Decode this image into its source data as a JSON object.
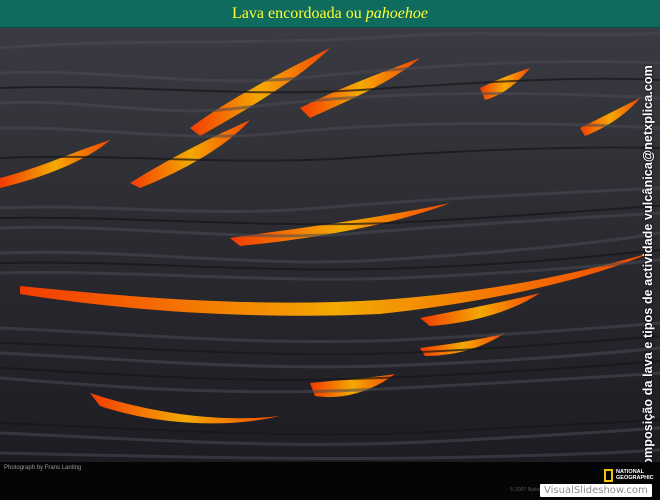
{
  "title": {
    "prefix": "Lava encordoada ou",
    "italic": "pahoehoe"
  },
  "side_caption": "Composição da lava e tipos de actividade vulcânica@netxplica.com",
  "photo_credit": "Photograph by Frans Lanting",
  "copyright": "© 2007 National Geographic Society",
  "ng_logo": {
    "line1": "NATIONAL",
    "line2": "GEOGRAPHIC"
  },
  "watermark": "VisualSlideshow.com",
  "colors": {
    "title_bar": "#0e6b5e",
    "title_text": "#ffff33",
    "lava_glow": "#ff6a00",
    "rock": "#2a2a30",
    "ng_yellow": "#f5c400"
  }
}
